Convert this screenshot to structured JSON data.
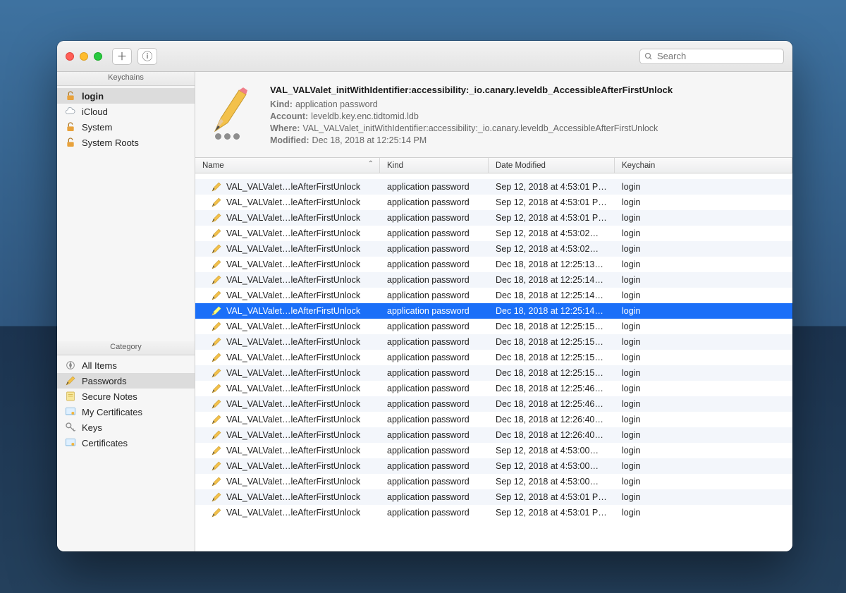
{
  "toolbar": {
    "search_placeholder": "Search"
  },
  "sidebar": {
    "title1": "Keychains",
    "title2": "Category",
    "keychains": [
      {
        "label": "login",
        "icon": "padlock-open-icon",
        "bold": true
      },
      {
        "label": "iCloud",
        "icon": "cloud-icon",
        "bold": false
      },
      {
        "label": "System",
        "icon": "padlock-open-icon",
        "bold": false
      },
      {
        "label": "System Roots",
        "icon": "padlock-open-icon",
        "bold": false
      }
    ],
    "categories": [
      {
        "label": "All Items",
        "icon": "compass-icon"
      },
      {
        "label": "Passwords",
        "icon": "pencil-icon"
      },
      {
        "label": "Secure Notes",
        "icon": "note-icon"
      },
      {
        "label": "My Certificates",
        "icon": "certificate-icon"
      },
      {
        "label": "Keys",
        "icon": "key-icon"
      },
      {
        "label": "Certificates",
        "icon": "certificate-icon"
      }
    ]
  },
  "detail": {
    "title": "VAL_VALValet_initWithIdentifier:accessibility:_io.canary.leveldb_AccessibleAfterFirstUnlock",
    "rows": [
      {
        "k": "Kind:",
        "v": "application password"
      },
      {
        "k": "Account:",
        "v": "leveldb.key.enc.tidtomid.ldb"
      },
      {
        "k": "Where:",
        "v": "VAL_VALValet_initWithIdentifier:accessibility:_io.canary.leveldb_AccessibleAfterFirstUnlock"
      },
      {
        "k": "Modified:",
        "v": "Dec 18, 2018 at 12:25:14 PM"
      }
    ]
  },
  "columns": {
    "name": "Name",
    "kind": "Kind",
    "date": "Date Modified",
    "keychain": "Keychain"
  },
  "rows": [
    {
      "name": "VAL_VALValet…leAfterFirstUnlock",
      "kind": "application password",
      "date": "Sep 12, 2018 at 4:53:01 P…",
      "keychain": "login",
      "top": true
    },
    {
      "name": "VAL_VALValet…leAfterFirstUnlock",
      "kind": "application password",
      "date": "Sep 12, 2018 at 4:53:01 P…",
      "keychain": "login"
    },
    {
      "name": "VAL_VALValet…leAfterFirstUnlock",
      "kind": "application password",
      "date": "Sep 12, 2018 at 4:53:01 P…",
      "keychain": "login"
    },
    {
      "name": "VAL_VALValet…leAfterFirstUnlock",
      "kind": "application password",
      "date": "Sep 12, 2018 at 4:53:02…",
      "keychain": "login"
    },
    {
      "name": "VAL_VALValet…leAfterFirstUnlock",
      "kind": "application password",
      "date": "Sep 12, 2018 at 4:53:02…",
      "keychain": "login"
    },
    {
      "name": "VAL_VALValet…leAfterFirstUnlock",
      "kind": "application password",
      "date": "Dec 18, 2018 at 12:25:13…",
      "keychain": "login"
    },
    {
      "name": "VAL_VALValet…leAfterFirstUnlock",
      "kind": "application password",
      "date": "Dec 18, 2018 at 12:25:14…",
      "keychain": "login"
    },
    {
      "name": "VAL_VALValet…leAfterFirstUnlock",
      "kind": "application password",
      "date": "Dec 18, 2018 at 12:25:14…",
      "keychain": "login"
    },
    {
      "name": "VAL_VALValet…leAfterFirstUnlock",
      "kind": "application password",
      "date": "Dec 18, 2018 at 12:25:14…",
      "keychain": "login",
      "selected": true
    },
    {
      "name": "VAL_VALValet…leAfterFirstUnlock",
      "kind": "application password",
      "date": "Dec 18, 2018 at 12:25:15…",
      "keychain": "login"
    },
    {
      "name": "VAL_VALValet…leAfterFirstUnlock",
      "kind": "application password",
      "date": "Dec 18, 2018 at 12:25:15…",
      "keychain": "login"
    },
    {
      "name": "VAL_VALValet…leAfterFirstUnlock",
      "kind": "application password",
      "date": "Dec 18, 2018 at 12:25:15…",
      "keychain": "login"
    },
    {
      "name": "VAL_VALValet…leAfterFirstUnlock",
      "kind": "application password",
      "date": "Dec 18, 2018 at 12:25:15…",
      "keychain": "login"
    },
    {
      "name": "VAL_VALValet…leAfterFirstUnlock",
      "kind": "application password",
      "date": "Dec 18, 2018 at 12:25:46…",
      "keychain": "login"
    },
    {
      "name": "VAL_VALValet…leAfterFirstUnlock",
      "kind": "application password",
      "date": "Dec 18, 2018 at 12:25:46…",
      "keychain": "login"
    },
    {
      "name": "VAL_VALValet…leAfterFirstUnlock",
      "kind": "application password",
      "date": "Dec 18, 2018 at 12:26:40…",
      "keychain": "login"
    },
    {
      "name": "VAL_VALValet…leAfterFirstUnlock",
      "kind": "application password",
      "date": "Dec 18, 2018 at 12:26:40…",
      "keychain": "login"
    },
    {
      "name": "VAL_VALValet…leAfterFirstUnlock",
      "kind": "application password",
      "date": "Sep 12, 2018 at 4:53:00…",
      "keychain": "login"
    },
    {
      "name": "VAL_VALValet…leAfterFirstUnlock",
      "kind": "application password",
      "date": "Sep 12, 2018 at 4:53:00…",
      "keychain": "login"
    },
    {
      "name": "VAL_VALValet…leAfterFirstUnlock",
      "kind": "application password",
      "date": "Sep 12, 2018 at 4:53:00…",
      "keychain": "login"
    },
    {
      "name": "VAL_VALValet…leAfterFirstUnlock",
      "kind": "application password",
      "date": "Sep 12, 2018 at 4:53:01 P…",
      "keychain": "login"
    },
    {
      "name": "VAL_VALValet…leAfterFirstUnlock",
      "kind": "application password",
      "date": "Sep 12, 2018 at 4:53:01 P…",
      "keychain": "login"
    }
  ]
}
